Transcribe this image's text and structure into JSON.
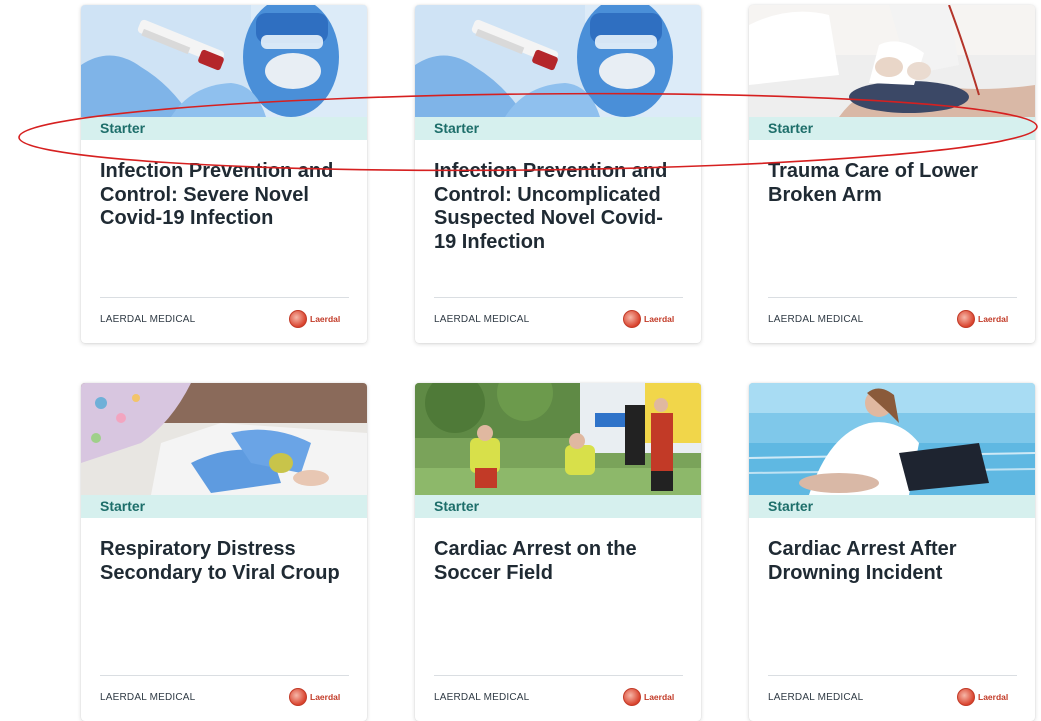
{
  "courses": [
    {
      "level": "Starter",
      "title": "Infection Prevention and Control: Severe Novel Covid-19 Infection",
      "publisher": "LAERDAL MEDICAL",
      "logo_text": "Laerdal",
      "image": "lab-worker-blood-sample"
    },
    {
      "level": "Starter",
      "title": "Infection Prevention and Control: Uncomplicated Suspected Novel Covid-19 Infection",
      "publisher": "LAERDAL MEDICAL",
      "logo_text": "Laerdal",
      "image": "lab-worker-blood-sample"
    },
    {
      "level": "Starter",
      "title": "Trauma Care of Lower Broken Arm",
      "publisher": "LAERDAL MEDICAL",
      "logo_text": "Laerdal",
      "image": "chest-compressions-manikin"
    },
    {
      "level": "Starter",
      "title": "Respiratory Distress Secondary to Viral Croup",
      "publisher": "LAERDAL MEDICAL",
      "logo_text": "Laerdal",
      "image": "infant-care-hands"
    },
    {
      "level": "Starter",
      "title": "Cardiac Arrest on the Soccer Field",
      "publisher": "LAERDAL MEDICAL",
      "logo_text": "Laerdal",
      "image": "paramedics-at-ambulance"
    },
    {
      "level": "Starter",
      "title": "Cardiac Arrest After Drowning Incident",
      "publisher": "LAERDAL MEDICAL",
      "logo_text": "Laerdal",
      "image": "cpr-by-pool"
    }
  ],
  "colors": {
    "level_band": "#d6f0ee",
    "level_text": "#1d6e6a",
    "title_text": "#1f2a33",
    "annotation_ellipse": "#d62020",
    "logo_red": "#c23a27"
  }
}
